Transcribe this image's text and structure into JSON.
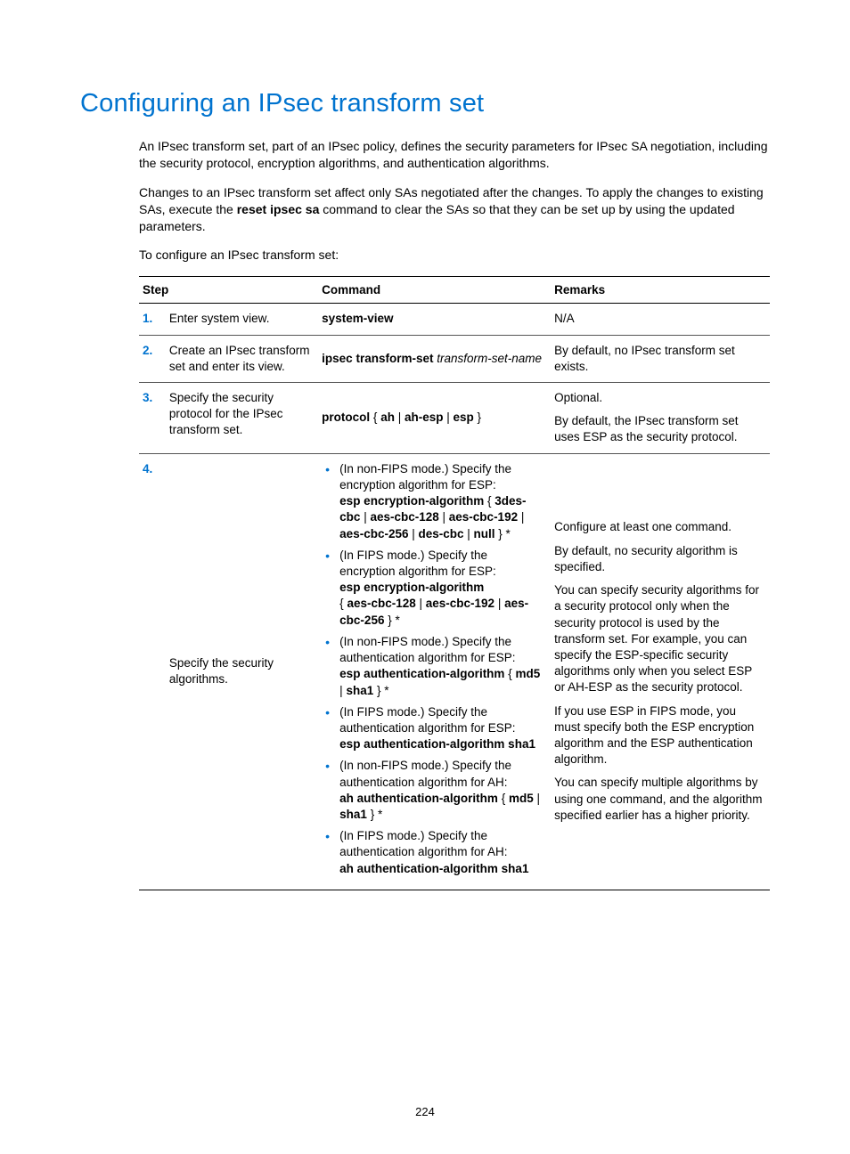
{
  "title": "Configuring an IPsec transform set",
  "intro1": "An IPsec transform set, part of an IPsec policy, defines the security parameters for IPsec SA negotiation, including the security protocol, encryption algorithms, and authentication algorithms.",
  "intro2_a": "Changes to an IPsec transform set affect only SAs negotiated after the changes. To apply the changes to existing SAs, execute the ",
  "intro2_bold": "reset ipsec sa",
  "intro2_b": " command to clear the SAs so that they can be set up by using the updated parameters.",
  "intro3": "To configure an IPsec transform set:",
  "table": {
    "headers": {
      "c1": "Step",
      "c2": "Command",
      "c3": "Remarks"
    },
    "r1": {
      "num": "1.",
      "step": "Enter system view.",
      "cmd": "system-view",
      "rem": "N/A"
    },
    "r2": {
      "num": "2.",
      "step": "Create an IPsec transform set and enter its view.",
      "cmd_bold": "ipsec transform-set",
      "cmd_italic": " transform-set-name",
      "rem": "By default, no IPsec transform set exists."
    },
    "r3": {
      "num": "3.",
      "step": "Specify the security protocol for the IPsec transform set.",
      "cmd_b1": "protocol",
      "cmd_t1": " { ",
      "cmd_b2": "ah",
      "cmd_t2": " | ",
      "cmd_b3": "ah-esp",
      "cmd_t3": " | ",
      "cmd_b4": "esp",
      "cmd_t4": " }",
      "rem1": "Optional.",
      "rem2": "By default, the IPsec transform set uses ESP as the security protocol."
    },
    "r4": {
      "num": "4.",
      "step": "Specify the security algorithms.",
      "li1_a": "(In non-FIPS mode.) Specify the encryption algorithm for ESP:",
      "li1_b1": "esp encryption-algorithm",
      "li1_t1": " { ",
      "li1_b2": "3des-cbc",
      "li1_t2": " | ",
      "li1_b3": "aes-cbc-128",
      "li1_t3": " | ",
      "li1_b4": "aes-cbc-192",
      "li1_t4": " | ",
      "li1_b5": "aes-cbc-256",
      "li1_t5": " | ",
      "li1_b6": "des-cbc",
      "li1_t6": " | ",
      "li1_b7": "null",
      "li1_t7": " } *",
      "li2_a": "(In FIPS mode.) Specify the encryption algorithm for ESP:",
      "li2_b1": "esp encryption-algorithm",
      "li2_t1": " { ",
      "li2_b2": "aes-cbc-128",
      "li2_t2": " | ",
      "li2_b3": "aes-cbc-192",
      "li2_t3": " | ",
      "li2_b4": "aes-cbc-256",
      "li2_t4": " } *",
      "li3_a": "(In non-FIPS mode.) Specify the authentication algorithm for ESP:",
      "li3_b1": "esp authentication-algorithm",
      "li3_t1": " { ",
      "li3_b2": "md5",
      "li3_t2": " | ",
      "li3_b3": "sha1",
      "li3_t3": " } *",
      "li4_a": "(In FIPS mode.) Specify the authentication algorithm for ESP:",
      "li4_b1": "esp authentication-algorithm sha1",
      "li5_a": "(In non-FIPS mode.) Specify the authentication algorithm for AH:",
      "li5_b1": "ah authentication-algorithm",
      "li5_t1": " { ",
      "li5_b2": "md5",
      "li5_t2": " | ",
      "li5_b3": "sha1",
      "li5_t3": " } *",
      "li6_a": "(In FIPS mode.) Specify the authentication algorithm for AH:",
      "li6_b1": "ah authentication-algorithm sha1",
      "rem1": "Configure at least one command.",
      "rem2": "By default, no security algorithm is specified.",
      "rem3": "You can specify security algorithms for a security protocol only when the security protocol is used by the transform set. For example, you can specify the ESP-specific security algorithms only when you select ESP or AH-ESP as the security protocol.",
      "rem4": "If you use ESP in FIPS mode, you must specify both the ESP encryption algorithm and the ESP authentication algorithm.",
      "rem5": "You can specify multiple algorithms by using one command, and the algorithm specified earlier has a higher priority."
    }
  },
  "page_number": "224"
}
